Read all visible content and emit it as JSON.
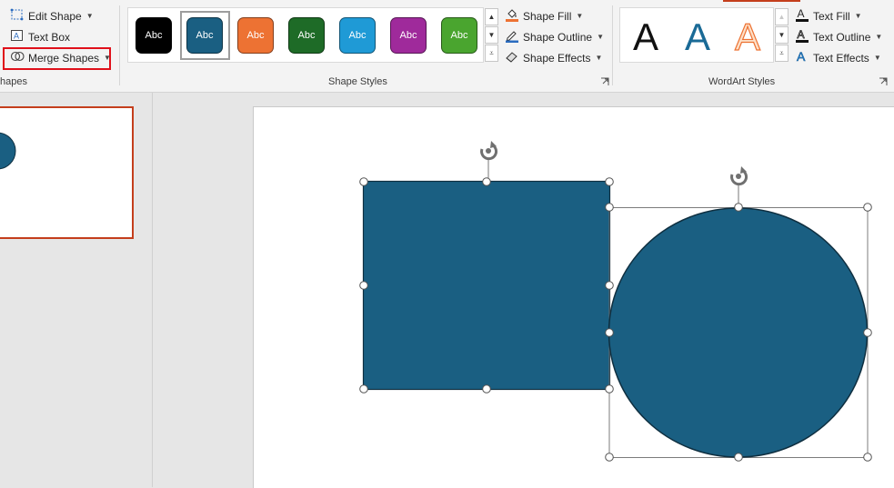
{
  "ribbon": {
    "insert_shapes": {
      "edit_shape": "Edit Shape",
      "text_box": "Text Box",
      "merge_shapes": "Merge Shapes",
      "group_label_partial": "hapes"
    },
    "shape_styles": {
      "group_label": "Shape Styles",
      "swatches": [
        {
          "label": "Abc",
          "color": "#000000"
        },
        {
          "label": "Abc",
          "color": "#1a5f82"
        },
        {
          "label": "Abc",
          "color": "#ed7233"
        },
        {
          "label": "Abc",
          "color": "#1e6b27"
        },
        {
          "label": "Abc",
          "color": "#1f9ad6"
        },
        {
          "label": "Abc",
          "color": "#9f2a9b"
        },
        {
          "label": "Abc",
          "color": "#4aa52f"
        }
      ],
      "shape_fill": "Shape Fill",
      "shape_outline": "Shape Outline",
      "shape_effects": "Shape Effects"
    },
    "wordart_styles": {
      "group_label": "WordArt Styles",
      "samples": [
        {
          "letter": "A",
          "style": "black"
        },
        {
          "letter": "A",
          "style": "blue"
        },
        {
          "letter": "A",
          "style": "orange-outline"
        }
      ],
      "text_fill": "Text Fill",
      "text_outline": "Text Outline",
      "text_effects": "Text Effects"
    }
  },
  "colors": {
    "shape_fill": "#1a5f82",
    "shape_outline": "#0f2f40",
    "selected_thumb_border": "#c43e1c",
    "merge_highlight": "#e0101a"
  },
  "icons": {
    "edit_shape": "edit-shape-icon",
    "text_box": "text-box-icon",
    "merge_shapes": "merge-shapes-icon",
    "shape_fill": "paint-bucket-icon",
    "shape_outline": "pen-outline-icon",
    "shape_effects": "eraser-effects-icon",
    "text_fill": "text-fill-a-icon",
    "text_outline": "text-outline-a-icon",
    "text_effects": "text-effects-a-icon",
    "rotate": "rotate-handle-icon"
  }
}
